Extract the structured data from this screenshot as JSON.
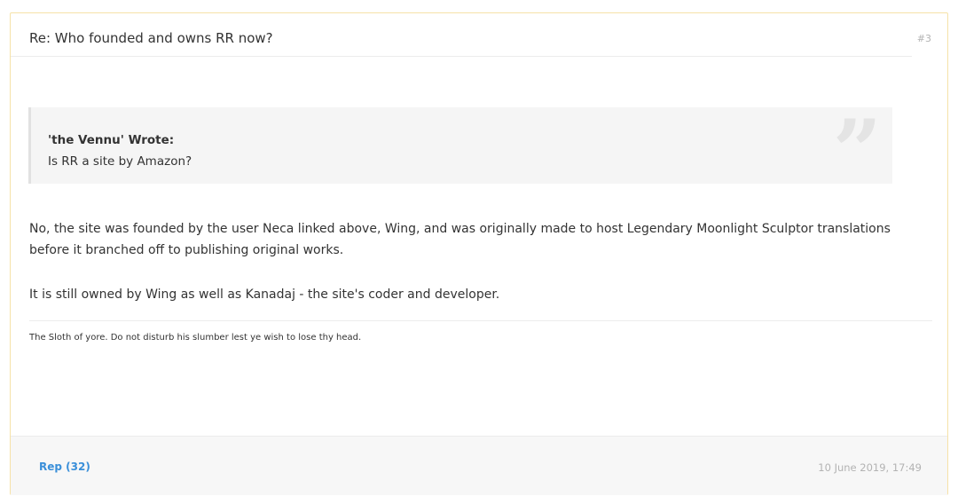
{
  "post": {
    "title": "Re: Who founded and owns RR now?",
    "number": "#3",
    "quote": {
      "author": "'the Vennu' Wrote:",
      "text": "Is RR a site by Amazon?",
      "icon": "quote-marks-icon",
      "icon_glyph": "”"
    },
    "paragraphs": [
      "No, the site was founded by the user Neca linked above, Wing, and was originally made to host Legendary Moonlight Sculptor translations before it branched off to publishing original works.",
      "It is still owned by Wing as well as Kanadaj - the site's coder and developer."
    ],
    "signature": "The Sloth of yore. Do not disturb his slumber lest ye wish to lose thy head.",
    "footer": {
      "rep_label": "Rep (32)",
      "date": "10 June 2019, 17:49"
    }
  },
  "colors": {
    "border": "#f6e2a8",
    "link": "#3a8fd9",
    "muted": "#b3b3b3",
    "quote_bg": "#f5f5f5",
    "footer_bg": "#f7f7f7"
  }
}
